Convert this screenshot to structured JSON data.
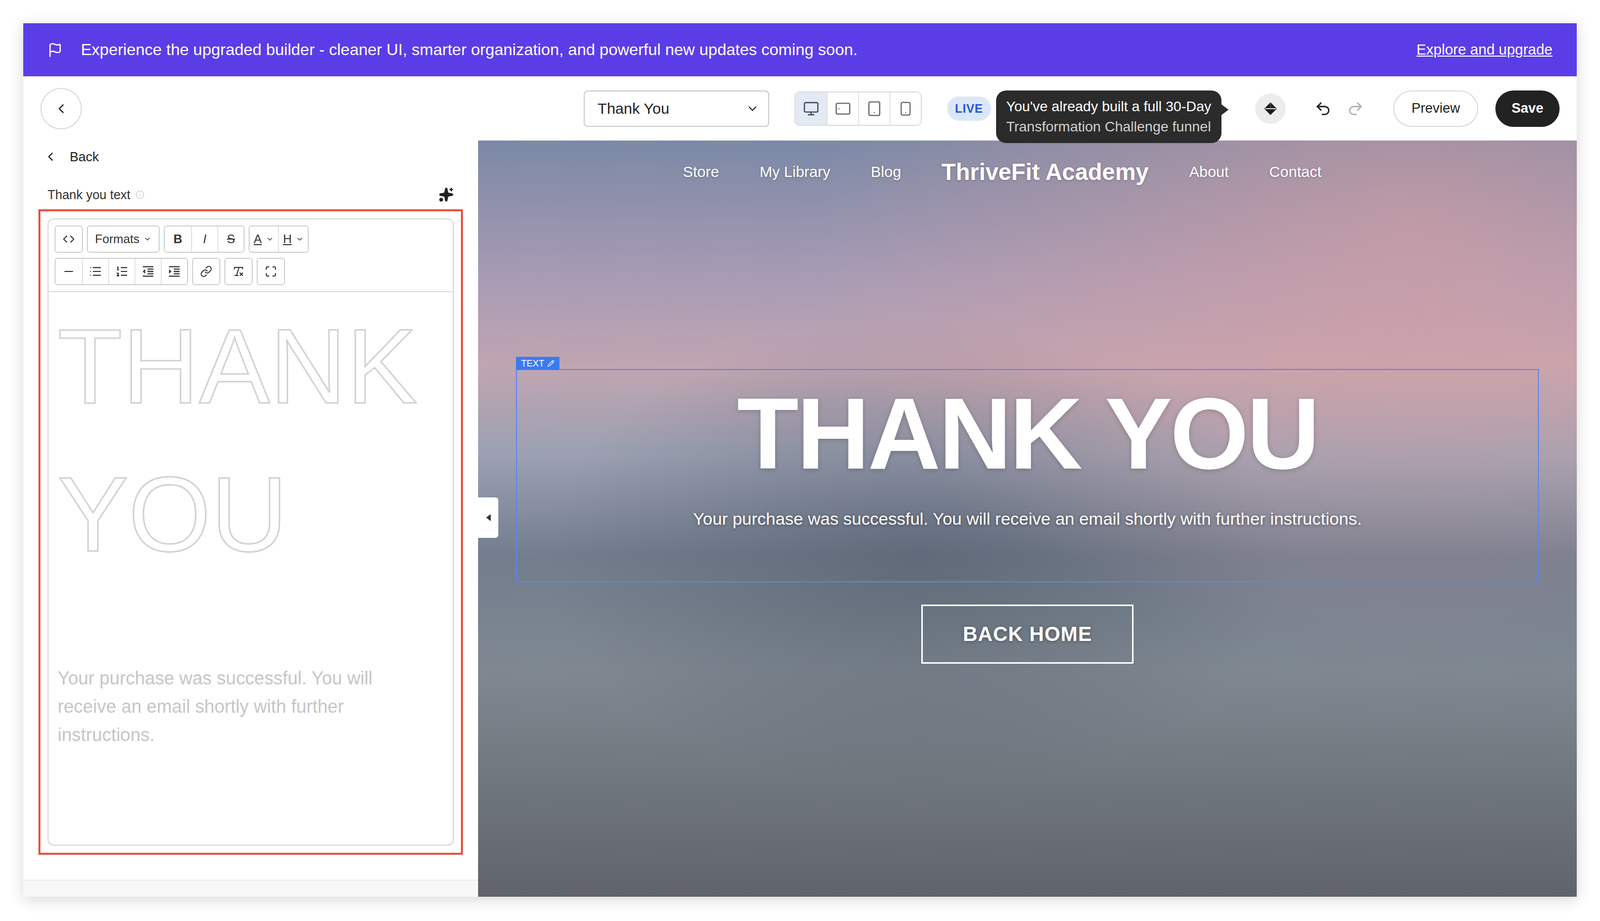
{
  "banner": {
    "text": "Experience the upgraded builder - cleaner UI, smarter organization, and powerful new updates coming soon.",
    "link": "Explore and upgrade"
  },
  "topbar": {
    "page_select": {
      "value": "Thank You"
    },
    "devices": [
      {
        "kind": "desktop",
        "selected": true
      },
      {
        "kind": "tablet-landscape",
        "selected": false
      },
      {
        "kind": "tablet",
        "selected": false
      },
      {
        "kind": "mobile",
        "selected": false
      }
    ],
    "status": "LIVE",
    "tooltip": [
      "You've already built a full 30-Day",
      "Transformation Challenge funnel"
    ],
    "history": [
      {
        "kind": "undo",
        "disabled": false
      },
      {
        "kind": "redo",
        "disabled": true
      }
    ],
    "buttons": [
      {
        "label": "Preview",
        "kind": "secondary"
      },
      {
        "label": "Save",
        "kind": "primary"
      }
    ]
  },
  "sidebar": {
    "back": "Back",
    "field": {
      "label": "Thank you text"
    },
    "toolbar": [
      [
        [
          {
            "kind": "code"
          }
        ],
        [
          {
            "kind": "menu",
            "label": "Formats"
          }
        ],
        [
          {
            "kind": "bold",
            "label": "B"
          },
          {
            "kind": "italic",
            "label": "I"
          },
          {
            "kind": "strike",
            "label": "S"
          }
        ],
        [
          {
            "kind": "color",
            "label": "A"
          },
          {
            "kind": "heading",
            "label": "H"
          }
        ]
      ],
      [
        [
          {
            "kind": "rule"
          },
          {
            "kind": "bullets"
          },
          {
            "kind": "numbers"
          },
          {
            "kind": "outdent"
          },
          {
            "kind": "indent"
          }
        ],
        [
          {
            "kind": "link"
          }
        ],
        [
          {
            "kind": "clear"
          }
        ],
        [
          {
            "kind": "fullscreen"
          }
        ]
      ]
    ],
    "editor": {
      "heading": "THANK YOU",
      "body": "Your purchase was successful. You will receive an email shortly with further instructions."
    }
  },
  "canvas": {
    "nav": [
      {
        "label": "Store",
        "kind": "link"
      },
      {
        "label": "My Library",
        "kind": "link"
      },
      {
        "label": "Blog",
        "kind": "link"
      },
      {
        "label": "ThriveFit Academy",
        "kind": "brand"
      },
      {
        "label": "About",
        "kind": "link"
      },
      {
        "label": "Contact",
        "kind": "link"
      }
    ],
    "selection_tag": "TEXT",
    "heading": "THANK YOU",
    "subtitle": "Your purchase was successful. You will receive an email shortly with further instructions.",
    "button": "BACK HOME"
  }
}
